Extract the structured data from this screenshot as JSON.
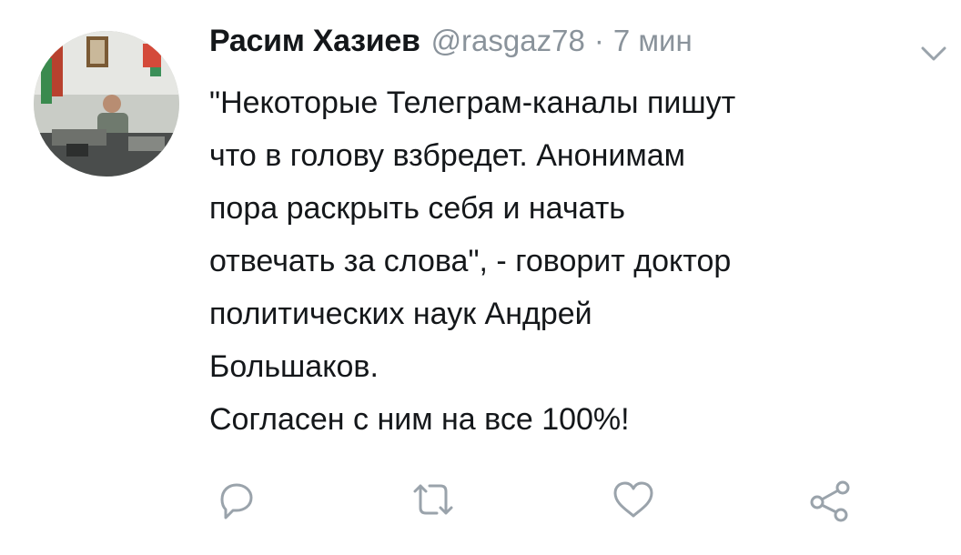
{
  "author": {
    "name": "Расим Хазиев",
    "handle": "@rasgaz78",
    "separator": "·",
    "time": "7 мин"
  },
  "tweet": {
    "lines": [
      "\"Некоторые Телеграм-каналы пишут",
      "что в голову взбредет. Анонимам",
      "пора раскрыть себя и начать",
      "отвечать за слова\", - говорит доктор",
      "политических наук Андрей",
      "Большаков.",
      "Согласен с ним на все 100%!"
    ]
  },
  "icons": {
    "caret": "chevron-down-icon",
    "reply": "reply-icon",
    "retweet": "retweet-icon",
    "like": "heart-icon",
    "share": "share-icon"
  },
  "colors": {
    "text": "#14171a",
    "secondary": "#8a939b",
    "icon": "#9aa3ab"
  }
}
